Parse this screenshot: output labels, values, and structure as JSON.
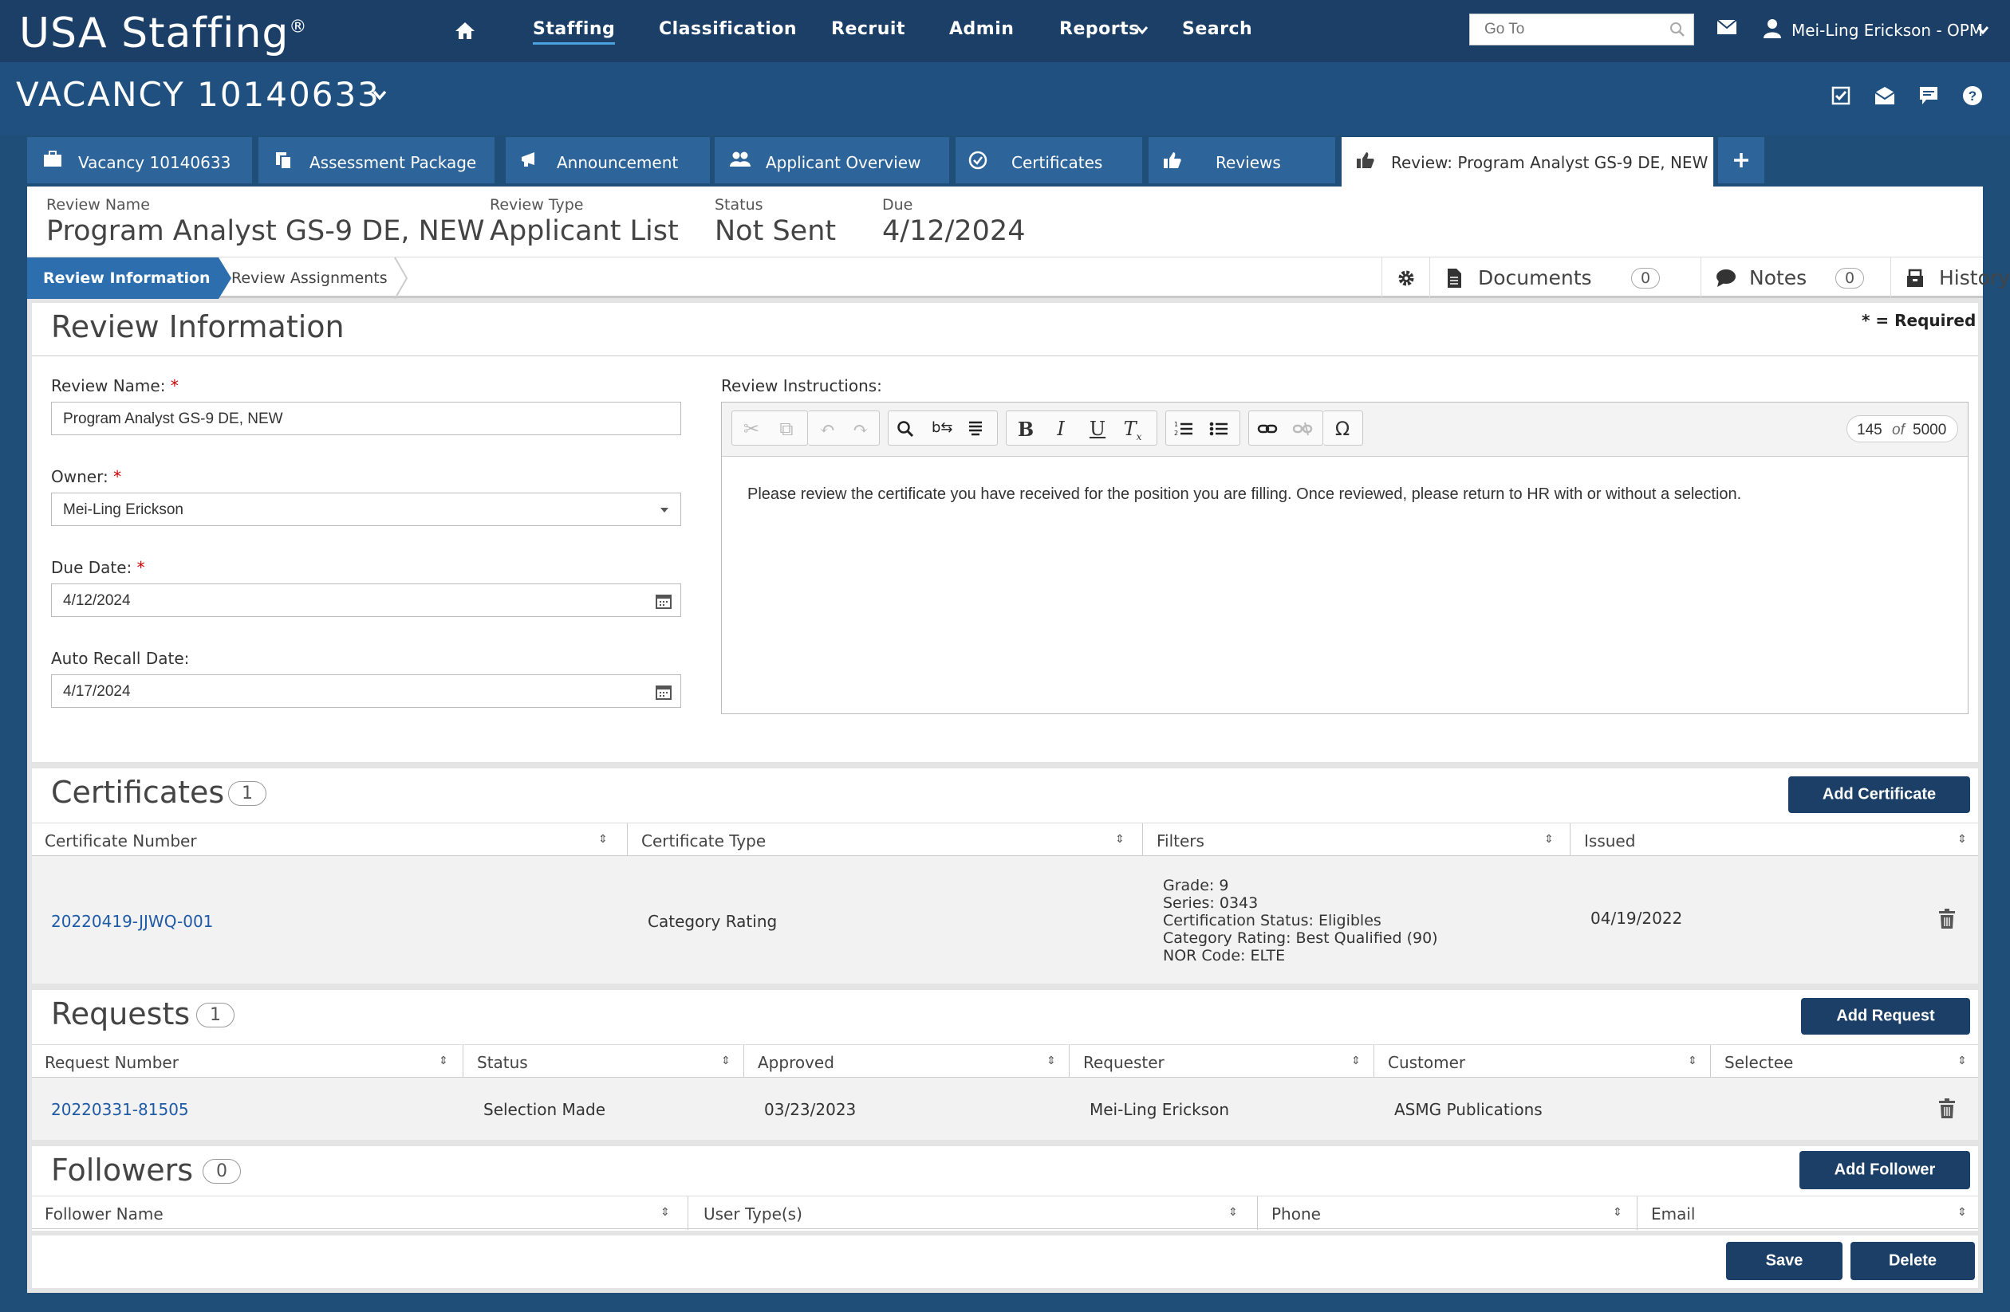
{
  "app": {
    "logo": "USA Staffing",
    "logo_mark": "®",
    "nav": [
      "Staffing",
      "Classification",
      "Recruit",
      "Admin",
      "Reports",
      "Search"
    ],
    "goto_placeholder": "Go To",
    "user": "Mei-Ling Erickson - OPM"
  },
  "vacancy": {
    "title": "VACANCY 10140633"
  },
  "tabs": [
    {
      "label": "Vacancy 10140633",
      "icon": "briefcase-icon"
    },
    {
      "label": "Assessment Package",
      "icon": "copy-icon"
    },
    {
      "label": "Announcement",
      "icon": "megaphone-icon"
    },
    {
      "label": "Applicant Overview",
      "icon": "users-icon"
    },
    {
      "label": "Certificates",
      "icon": "check-circle-icon"
    },
    {
      "label": "Reviews",
      "icon": "thumbs-up-icon"
    },
    {
      "label": "Review: Program Analyst GS-9 DE, NEW",
      "icon": "thumbs-up-icon"
    }
  ],
  "summary": {
    "review_name_label": "Review Name",
    "review_name": "Program Analyst GS-9 DE, NEW",
    "review_type_label": "Review Type",
    "review_type": "Applicant List",
    "status_label": "Status",
    "status": "Not Sent",
    "due_label": "Due",
    "due": "4/12/2024"
  },
  "subnav": {
    "steps": [
      "Review Information",
      "Review Assignments"
    ],
    "documents_label": "Documents",
    "documents_count": "0",
    "notes_label": "Notes",
    "notes_count": "0",
    "history_label": "History"
  },
  "review_info": {
    "title": "Review Information",
    "required_note": "* = Required",
    "name_label": "Review Name:",
    "name_value": "Program Analyst GS-9 DE, NEW",
    "owner_label": "Owner:",
    "owner_value": "Mei-Ling Erickson",
    "due_label": "Due Date:",
    "due_value": "4/12/2024",
    "recall_label": "Auto Recall Date:",
    "recall_value": "4/17/2024",
    "instructions_label": "Review Instructions:",
    "char_count": "145",
    "char_of": "of",
    "char_max": "5000",
    "instructions_text": "Please review the certificate you have received for the position you are filling. Once reviewed, please return to HR with or without a selection."
  },
  "certificates": {
    "title": "Certificates",
    "count": "1",
    "add_label": "Add Certificate",
    "columns": [
      "Certificate Number",
      "Certificate Type",
      "Filters",
      "Issued"
    ],
    "rows": [
      {
        "number": "20220419-JJWQ-001",
        "type": "Category Rating",
        "filters": [
          "Grade: 9",
          "Series: 0343",
          "Certification Status: Eligibles",
          "Category Rating: Best Qualified (90)",
          "NOR Code: ELTE"
        ],
        "issued": "04/19/2022"
      }
    ]
  },
  "requests": {
    "title": "Requests",
    "count": "1",
    "add_label": "Add Request",
    "columns": [
      "Request Number",
      "Status",
      "Approved",
      "Requester",
      "Customer",
      "Selectee"
    ],
    "rows": [
      {
        "number": "20220331-81505",
        "status": "Selection Made",
        "approved": "03/23/2023",
        "requester": "Mei-Ling Erickson",
        "customer": "ASMG Publications",
        "selectee": ""
      }
    ]
  },
  "followers": {
    "title": "Followers",
    "count": "0",
    "add_label": "Add Follower",
    "columns": [
      "Follower Name",
      "User Type(s)",
      "Phone",
      "Email"
    ]
  },
  "actions": {
    "save": "Save",
    "delete": "Delete"
  }
}
